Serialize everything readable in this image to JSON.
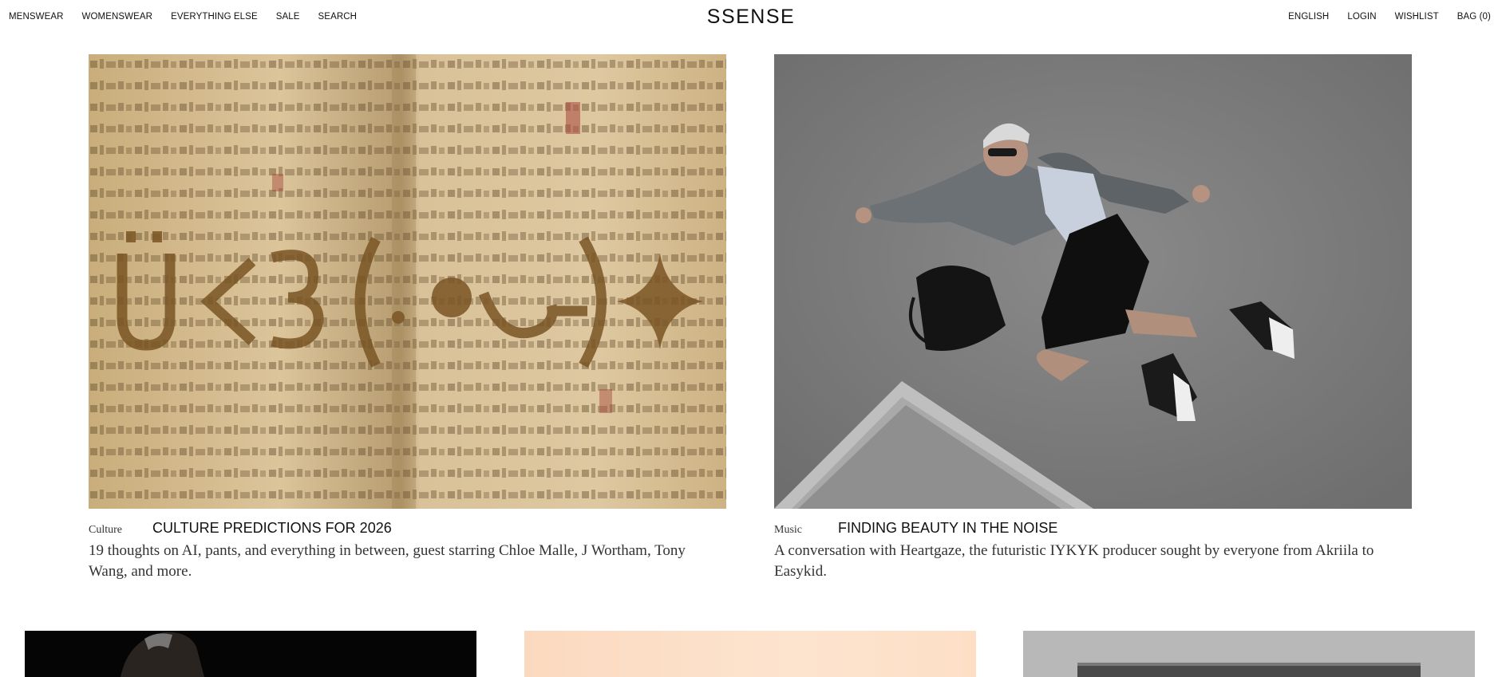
{
  "nav": {
    "left_items": [
      "MENSWEAR",
      "WOMENSWEAR",
      "EVERYTHING ELSE",
      "SALE",
      "SEARCH"
    ],
    "logo": "SSENSE",
    "right_items": [
      "ENGLISH",
      "LOGIN",
      "WISHLIST",
      "BAG (0)"
    ]
  },
  "features": [
    {
      "category": "Culture",
      "headline": "CULTURE PREDICTIONS FOR 2026",
      "dek": "19 thoughts on AI, pants, and everything in between, guest starring Chloe Malle, J Wortham, Tony Wang, and more.",
      "image_overlay_text": "Ü<3(.•‿•)✦"
    },
    {
      "category": "Music",
      "headline": "FINDING BEAUTY IN THE NOISE",
      "dek": "A conversation with Heartgaze, the futuristic IYKYK producer sought by everyone from Akriila to Easykid."
    }
  ],
  "colors": {
    "parchment": "#d8c39a",
    "ink": "#6b4a22",
    "asphalt": "#7c7c7c",
    "text": "#111111"
  }
}
